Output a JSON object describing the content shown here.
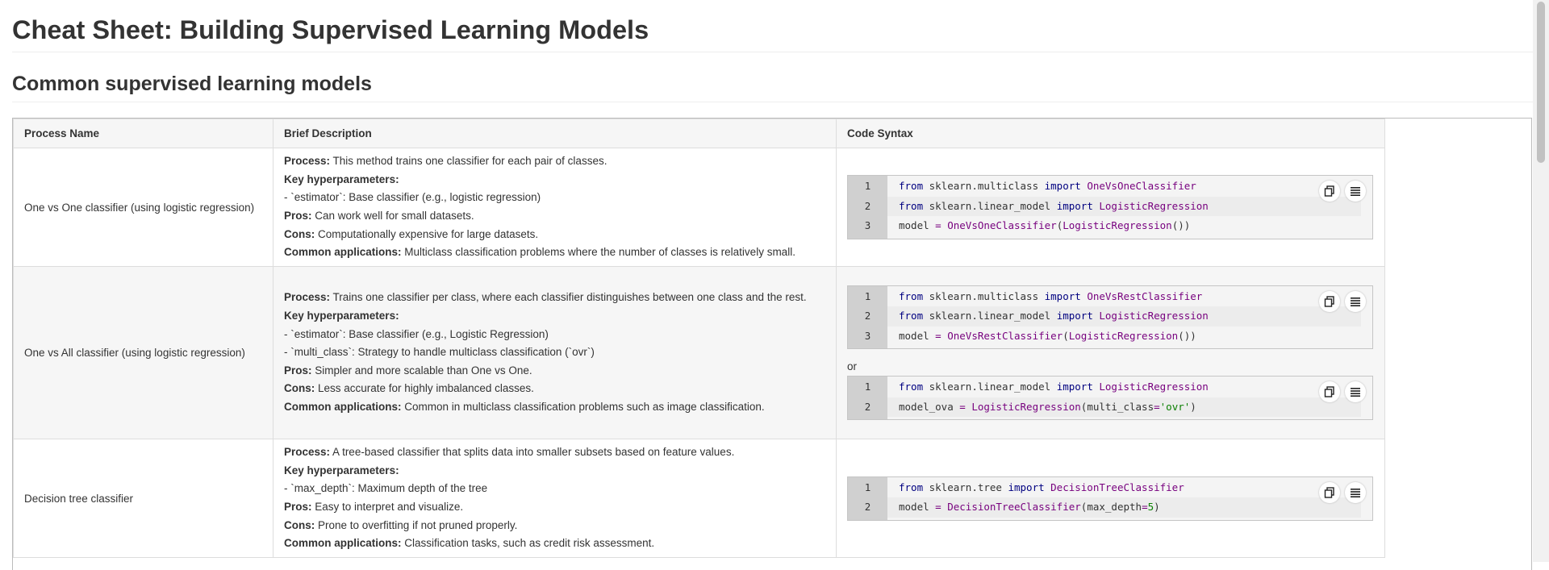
{
  "title": "Cheat Sheet: Building Supervised Learning Models",
  "section_title": "Common supervised learning models",
  "table": {
    "headers": [
      "Process Name",
      "Brief Description",
      "Code Syntax"
    ],
    "rows": [
      {
        "name": "One vs One classifier (using logistic regression)",
        "desc": [
          {
            "label": "Process:",
            "text": " This method trains one classifier for each pair of classes."
          },
          {
            "label": "Key hyperparameters:",
            "text": ""
          },
          {
            "label": "",
            "text": "- `estimator`: Base classifier (e.g., logistic regression)"
          },
          {
            "label": "Pros:",
            "text": " Can work well for small datasets."
          },
          {
            "label": "Cons:",
            "text": " Computationally expensive for large datasets."
          },
          {
            "label": "Common applications:",
            "text": " Multiclass classification problems where the number of classes is relatively small."
          }
        ],
        "code_blocks": [
          {
            "line_numbers": [
              "1",
              "2",
              "3"
            ]
          }
        ]
      },
      {
        "name": "One vs All classifier (using logistic regression)",
        "desc": [
          {
            "label": "Process:",
            "text": " Trains one classifier per class, where each classifier distinguishes between one class and the rest."
          },
          {
            "label": "Key hyperparameters:",
            "text": ""
          },
          {
            "label": "",
            "text": "- `estimator`: Base classifier (e.g., Logistic Regression)"
          },
          {
            "label": "",
            "text": "- `multi_class`: Strategy to handle multiclass classification (`ovr`)"
          },
          {
            "label": "Pros:",
            "text": " Simpler and more scalable than One vs One."
          },
          {
            "label": "Cons:",
            "text": " Less accurate for highly imbalanced classes."
          },
          {
            "label": "Common applications:",
            "text": " Common in multiclass classification problems such as image classification."
          }
        ],
        "or_label": "or",
        "code_blocks": [
          {
            "line_numbers": [
              "1",
              "2",
              "3"
            ]
          },
          {
            "line_numbers": [
              "1",
              "2"
            ]
          }
        ]
      },
      {
        "name": "Decision tree classifier",
        "desc": [
          {
            "label": "Process:",
            "text": " A tree-based classifier that splits data into smaller subsets based on feature values."
          },
          {
            "label": "Key hyperparameters:",
            "text": ""
          },
          {
            "label": "",
            "text": "- `max_depth`: Maximum depth of the tree"
          },
          {
            "label": "Pros:",
            "text": " Easy to interpret and visualize."
          },
          {
            "label": "Cons:",
            "text": " Prone to overfitting if not pruned properly."
          },
          {
            "label": "Common applications:",
            "text": " Classification tasks, such as credit risk assessment."
          }
        ],
        "code_blocks": [
          {
            "line_numbers": [
              "1",
              "2"
            ]
          }
        ]
      }
    ]
  },
  "code": {
    "from": "from",
    "import": "import",
    "eq": "=",
    "multiclass_mod": " sklearn.multiclass ",
    "linear_mod": " sklearn.linear_model ",
    "tree_mod": " sklearn.tree ",
    "ovo": "OneVsOneClassifier",
    "ovr": "OneVsRestClassifier",
    "lr": "LogisticRegression",
    "dt": "DecisionTreeClassifier",
    "model": "model ",
    "model_ova": "model_ova ",
    "multi_class_kw": "multi_class",
    "ovr_str": "'ovr'",
    "max_depth_kw": "max_depth",
    "five": "5",
    "paren_open": "(",
    "paren_close": ")",
    "paren_close2": "())",
    "unit_parens": "()"
  },
  "icons": {
    "copy": "copy-icon",
    "wrap": "wrap-lines-icon"
  },
  "colors": {
    "keyword": "#000080",
    "class": "#77007e",
    "string": "#0a7f00"
  }
}
